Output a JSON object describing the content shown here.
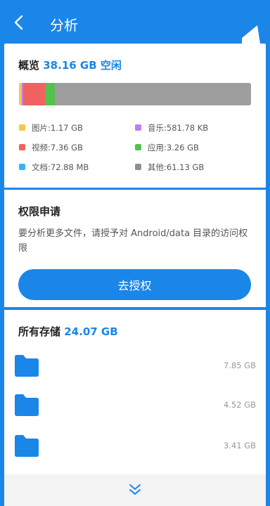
{
  "header": {
    "title": "分析"
  },
  "overview": {
    "label": "概览",
    "free_amount": "38.16 GB 空闲",
    "bar_segments": [
      {
        "name": "images",
        "fraction": 0.012,
        "color": "#f5c64a"
      },
      {
        "name": "music",
        "fraction": 0.006,
        "color": "#c77be8"
      },
      {
        "name": "videos",
        "fraction": 0.095,
        "color": "#f0625f"
      },
      {
        "name": "apps",
        "fraction": 0.042,
        "color": "#53c24a"
      },
      {
        "name": "docs",
        "fraction": 0.001,
        "color": "#3bb3f0"
      },
      {
        "name": "other",
        "fraction": 0.844,
        "color": "#9e9e9e"
      }
    ],
    "legend": [
      {
        "label": "图片:1.17 GB",
        "color": "#f5c64a"
      },
      {
        "label": "音乐:581.78 KB",
        "color": "#c77be8"
      },
      {
        "label": "视频:7.36 GB",
        "color": "#f0625f"
      },
      {
        "label": "应用:3.26 GB",
        "color": "#53c24a"
      },
      {
        "label": "文档:72.88 MB",
        "color": "#3bb3f0"
      },
      {
        "label": "其他:61.13 GB",
        "color": "#8f8f8f"
      }
    ]
  },
  "permission": {
    "title": "权限申请",
    "description": "要分析更多文件，请授予对 Android/data 目录的访问权限",
    "button_label": "去授权"
  },
  "storage": {
    "label": "所有存储",
    "total": "24.07 GB",
    "folders": [
      {
        "size": "7.85 GB"
      },
      {
        "size": "4.52 GB"
      },
      {
        "size": "3.41 GB"
      }
    ]
  },
  "colors": {
    "accent": "#1a86e8",
    "folder": "#1a86e8"
  }
}
